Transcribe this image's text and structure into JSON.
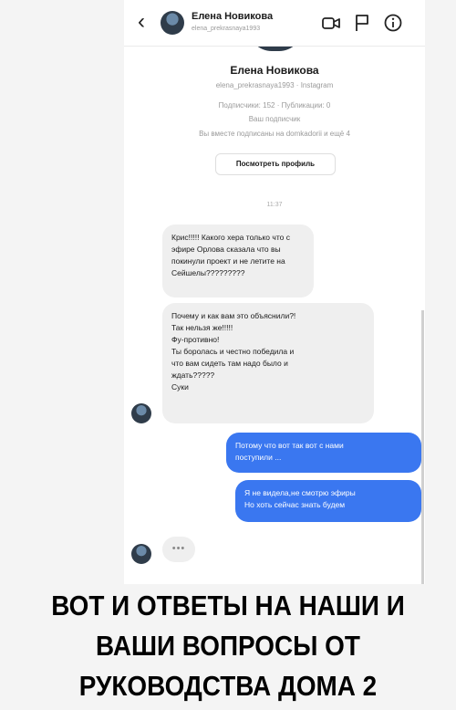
{
  "header": {
    "back_icon": "chevron-left-icon",
    "name": "Елена Новикова",
    "username": "elena_prekrasnaya1993",
    "icons": [
      "video-call-icon",
      "flag-icon",
      "info-icon"
    ]
  },
  "profile": {
    "name": "Елена Новикова",
    "handle_line": "elena_prekrasnaya1993 · Instagram",
    "stats_line": "Подписчики: 152 · Публикации: 0",
    "follow_line": "Ваш подписчик",
    "mutual_line": "Вы вместе подписаны на domkadorii и ещё 4",
    "view_profile_label": "Посмотреть профиль"
  },
  "chat": {
    "timestamp": "11:37",
    "incoming_1": [
      "Крис!!!!! Какого хера только что с",
      "эфире Орлова сказала что вы",
      "покинули проект и не летите на",
      "Сейшелы?????????"
    ],
    "incoming_2": [
      "Почему и как вам это объяснили?!",
      "Так нельзя же!!!!!",
      "Фу-противно!",
      "Ты боролась и честно победила и",
      "что вам сидеть там надо было и",
      "ждать?????",
      "Суки"
    ],
    "outgoing_1": [
      "Потому что вот так вот с нами",
      "поступили ..."
    ],
    "outgoing_2": [
      "Я не видела,не смотрю эфиры",
      "Но хоть сейчас знать будем"
    ],
    "typing_indicator": "•••"
  },
  "caption": {
    "line1": "ВОТ И ОТВЕТЫ НА НАШИ И",
    "line2": "ВАШИ ВОПРОСЫ ОТ",
    "line3": "РУКОВОДСТВА ДОМА 2"
  },
  "colors": {
    "outgoing_bubble": "#3a77f0",
    "incoming_bubble": "#efefef",
    "background": "#f4f4f4"
  }
}
